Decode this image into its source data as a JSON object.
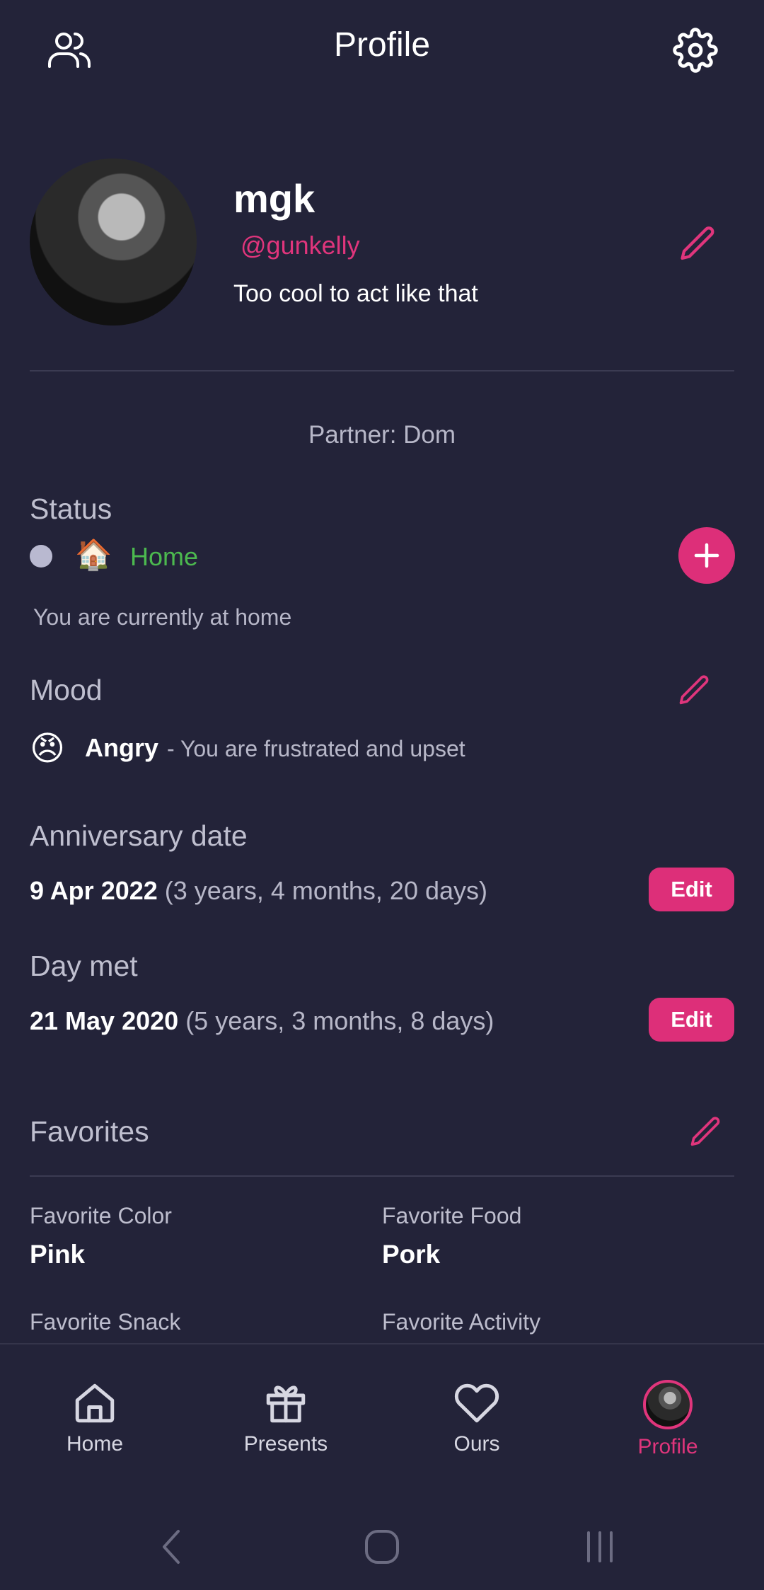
{
  "header": {
    "title": "Profile",
    "left_icon": "users-icon",
    "right_icon": "gear-icon"
  },
  "profile": {
    "name": "mgk",
    "handle": "@gunkelly",
    "bio": "Too cool to act like that",
    "edit_icon": "pencil-icon"
  },
  "partner": {
    "text": "Partner: Dom"
  },
  "status": {
    "heading": "Status",
    "emoji": "🏠",
    "label": "Home",
    "description": "You are currently at home",
    "add_icon": "plus-icon"
  },
  "mood": {
    "heading": "Mood",
    "emoji": "😠",
    "label": "Angry",
    "description": "- You are frustrated and upset"
  },
  "anniversary": {
    "heading": "Anniversary date",
    "date": "9 Apr 2022",
    "duration": "(3 years, 4 months, 20 days)",
    "button": "Edit"
  },
  "day_met": {
    "heading": "Day met",
    "date": "21 May 2020",
    "duration": "(5 years, 3 months, 8 days)",
    "button": "Edit"
  },
  "favorites": {
    "heading": "Favorites",
    "items": [
      {
        "label": "Favorite Color",
        "value": "Pink"
      },
      {
        "label": "Favorite Food",
        "value": "Pork"
      },
      {
        "label": "Favorite Snack",
        "value": ""
      },
      {
        "label": "Favorite Activity",
        "value": ""
      }
    ]
  },
  "bottom_nav": {
    "items": [
      {
        "label": "Home",
        "icon": "home-icon"
      },
      {
        "label": "Presents",
        "icon": "gift-icon"
      },
      {
        "label": "Ours",
        "icon": "heart-icon"
      },
      {
        "label": "Profile",
        "icon": "avatar"
      }
    ],
    "active": "Profile"
  },
  "colors": {
    "background": "#232339",
    "accent": "#dd2f79",
    "status_green": "#4cb94f"
  }
}
